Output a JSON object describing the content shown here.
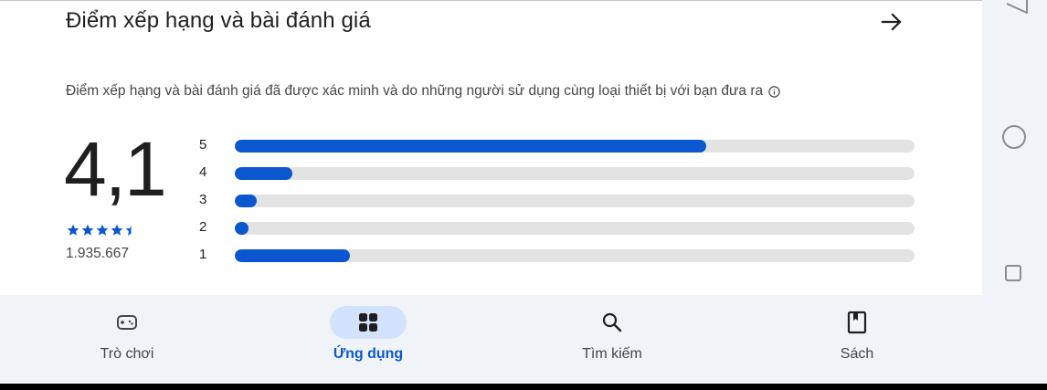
{
  "section": {
    "title": "Điểm xếp hạng và bài đánh giá",
    "description": "Điểm xếp hạng và bài đánh giá đã được xác minh và do những người sử dụng cùng loại thiết bị với bạn đưa ra"
  },
  "rating": {
    "value": "4,1",
    "stars": 4.5,
    "review_count": "1.935.667"
  },
  "distribution": [
    {
      "label": "5",
      "fraction": 0.694
    },
    {
      "label": "4",
      "fraction": 0.085
    },
    {
      "label": "3",
      "fraction": 0.032
    },
    {
      "label": "2",
      "fraction": 0.02
    },
    {
      "label": "1",
      "fraction": 0.17
    }
  ],
  "nav": {
    "items": [
      {
        "label": "Trò chơi",
        "icon": "gamepad-icon",
        "active": false
      },
      {
        "label": "Ứng dụng",
        "icon": "apps-grid-icon",
        "active": true
      },
      {
        "label": "Tìm kiếm",
        "icon": "search-icon",
        "active": false
      },
      {
        "label": "Sách",
        "icon": "book-icon",
        "active": false
      }
    ]
  },
  "colors": {
    "accent": "#0b57d0",
    "track": "#e3e3e3",
    "active_pill": "#d3e3fd",
    "text": "#1f1f1f",
    "muted": "#444746"
  }
}
